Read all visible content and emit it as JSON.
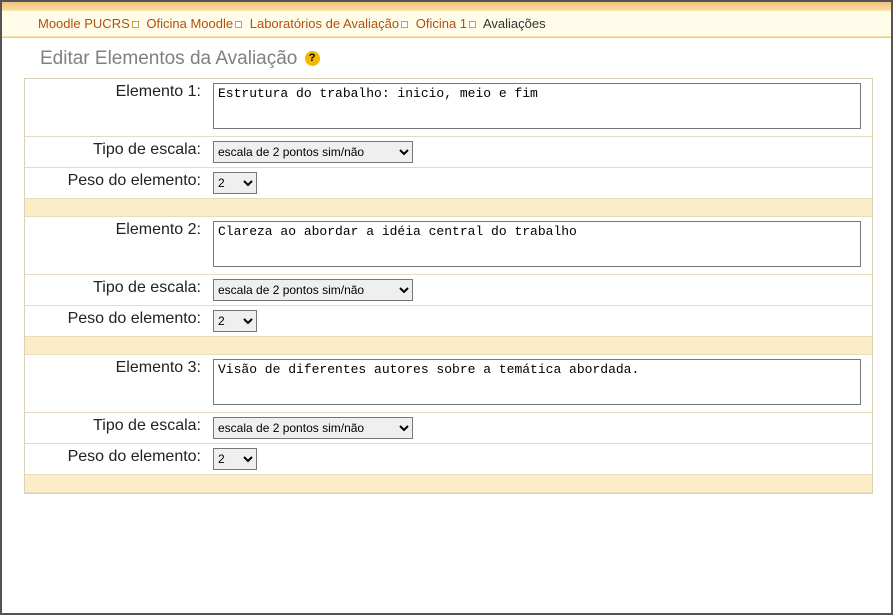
{
  "breadcrumb": {
    "items": [
      {
        "label": "Moodle PUCRS",
        "link": true
      },
      {
        "label": "Oficina Moodle",
        "link": true
      },
      {
        "label": "Laboratórios de Avaliação",
        "link": true
      },
      {
        "label": "Oficina 1",
        "link": true
      },
      {
        "label": "Avaliações",
        "link": false
      }
    ]
  },
  "page": {
    "title": "Editar Elementos da Avaliação"
  },
  "labels": {
    "scale": "Tipo de escala:",
    "weight": "Peso do elemento:"
  },
  "scale_options": [
    "escala de 2 pontos sim/não"
  ],
  "weight_options": [
    "2"
  ],
  "elements": [
    {
      "label": "Elemento 1:",
      "desc": "Estrutura do trabalho: inicio, meio e fim",
      "scale": "escala de 2 pontos sim/não",
      "weight": "2"
    },
    {
      "label": "Elemento 2:",
      "desc": "Clareza ao abordar a idéia central do trabalho",
      "scale": "escala de 2 pontos sim/não",
      "weight": "2"
    },
    {
      "label": "Elemento 3:",
      "desc": "Visão de diferentes autores sobre a temática abordada.",
      "scale": "escala de 2 pontos sim/não",
      "weight": "2"
    }
  ]
}
